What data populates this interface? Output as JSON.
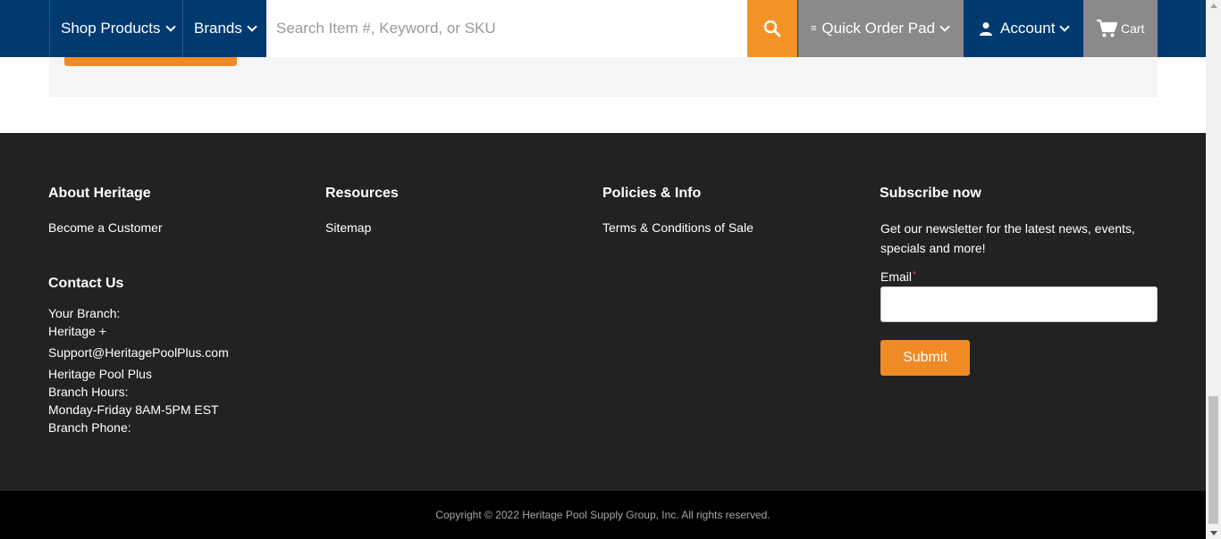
{
  "nav": {
    "shop_products": "Shop Products",
    "brands": "Brands",
    "search_placeholder": "Search Item #, Keyword, or SKU",
    "quick_order_pad": "Quick Order Pad",
    "account": "Account",
    "cart": "Cart"
  },
  "footer": {
    "about": {
      "heading": "About Heritage",
      "links": [
        "Become a Customer"
      ]
    },
    "resources": {
      "heading": "Resources",
      "links": [
        "Sitemap"
      ]
    },
    "policies": {
      "heading": "Policies & Info",
      "links": [
        "Terms & Conditions of Sale"
      ]
    },
    "contact": {
      "heading": "Contact Us",
      "your_branch_label": "Your Branch:",
      "branch_name": "Heritage +",
      "email": "Support@HeritagePoolPlus.com",
      "company": "Heritage Pool Plus",
      "hours_label": "Branch Hours:",
      "hours": "Monday-Friday 8AM-5PM EST",
      "phone_label": "Branch Phone:"
    },
    "subscribe": {
      "heading": "Subscribe now",
      "text": "Get our newsletter for the latest news, events, specials and more!",
      "email_label": "Email",
      "required_mark": "*",
      "submit": "Submit"
    },
    "copyright": "Copyright © 2022 Heritage Pool Supply Group, Inc. All rights reserved."
  },
  "colors": {
    "nav_blue": "#003a70",
    "accent_orange": "#f39325",
    "nav_grey": "#8a8a8a",
    "footer_bg": "#222222",
    "bottom_bar": "#000000"
  },
  "icons": [
    "chevron-down-icon",
    "search-icon",
    "barcode-icon",
    "user-icon",
    "cart-icon"
  ]
}
